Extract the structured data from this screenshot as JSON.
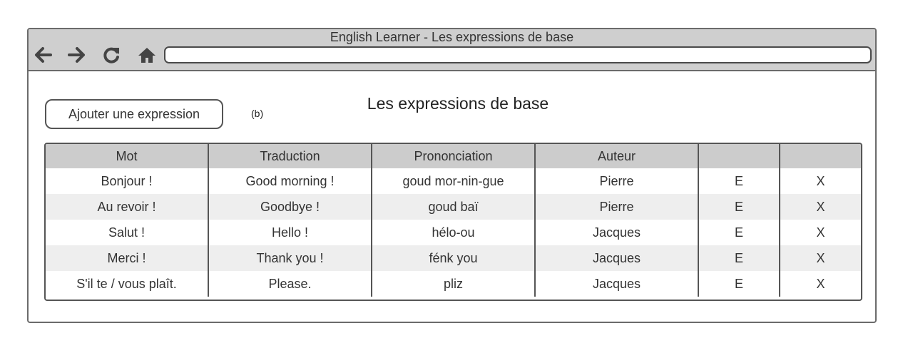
{
  "window": {
    "title": "English Learner - Les expressions de base"
  },
  "toolbar": {
    "back_icon": "arrow-left-icon",
    "forward_icon": "arrow-right-icon",
    "reload_icon": "reload-icon",
    "home_icon": "home-icon",
    "address_value": ""
  },
  "page": {
    "add_button_label": "Ajouter une expression",
    "annotation": "(b)",
    "title": "Les expressions de base"
  },
  "table": {
    "columns": [
      "Mot",
      "Traduction",
      "Prononciation",
      "Auteur",
      "",
      ""
    ],
    "rows": [
      {
        "mot": "Bonjour !",
        "traduction": "Good morning !",
        "prononciation": "goud mor-nin-gue",
        "auteur": "Pierre",
        "edit": "E",
        "delete": "X"
      },
      {
        "mot": "Au revoir !",
        "traduction": "Goodbye !",
        "prononciation": "goud baï",
        "auteur": "Pierre",
        "edit": "E",
        "delete": "X"
      },
      {
        "mot": "Salut !",
        "traduction": "Hello !",
        "prononciation": "hélo-ou",
        "auteur": "Jacques",
        "edit": "E",
        "delete": "X"
      },
      {
        "mot": "Merci !",
        "traduction": "Thank you !",
        "prononciation": "fénk you",
        "auteur": "Jacques",
        "edit": "E",
        "delete": "X"
      },
      {
        "mot": "S'il te / vous plaît.",
        "traduction": "Please.",
        "prononciation": "pliz",
        "auteur": "Jacques",
        "edit": "E",
        "delete": "X"
      }
    ]
  },
  "colors": {
    "titlebar": "#cfcfcf",
    "border": "#555555",
    "header_row": "#cccccc",
    "alt_row": "#eeeeee"
  }
}
